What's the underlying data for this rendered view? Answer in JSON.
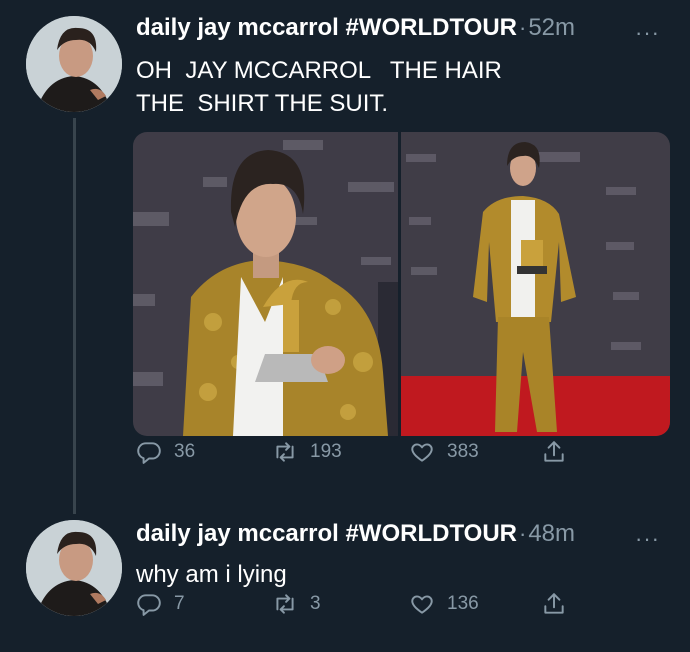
{
  "tweets": [
    {
      "author": "daily jay mccarrol #WORLDTOUR",
      "separator": "·",
      "time": "52m",
      "more": "···",
      "lines": [
        "OH  JAY MCCARROL   THE HAIR",
        "THE  SHIRT THE SUIT."
      ],
      "replies": "36",
      "retweets": "193",
      "likes": "383"
    },
    {
      "author": "daily jay mccarrol #WORLDTOUR",
      "separator": "·",
      "time": "48m",
      "more": "···",
      "lines": [
        "why am i lying"
      ],
      "replies": "7",
      "retweets": "3",
      "likes": "136"
    }
  ],
  "icons": {
    "reply": "reply-icon",
    "retweet": "retweet-icon",
    "like": "heart-icon",
    "share": "share-icon",
    "more": "more-icon"
  },
  "colors": {
    "background": "#15202b",
    "text": "#ffffff",
    "muted": "#8899a6",
    "thread_line": "#38444d",
    "gold_suit": "#b8912e",
    "red_carpet": "#c0191f"
  }
}
